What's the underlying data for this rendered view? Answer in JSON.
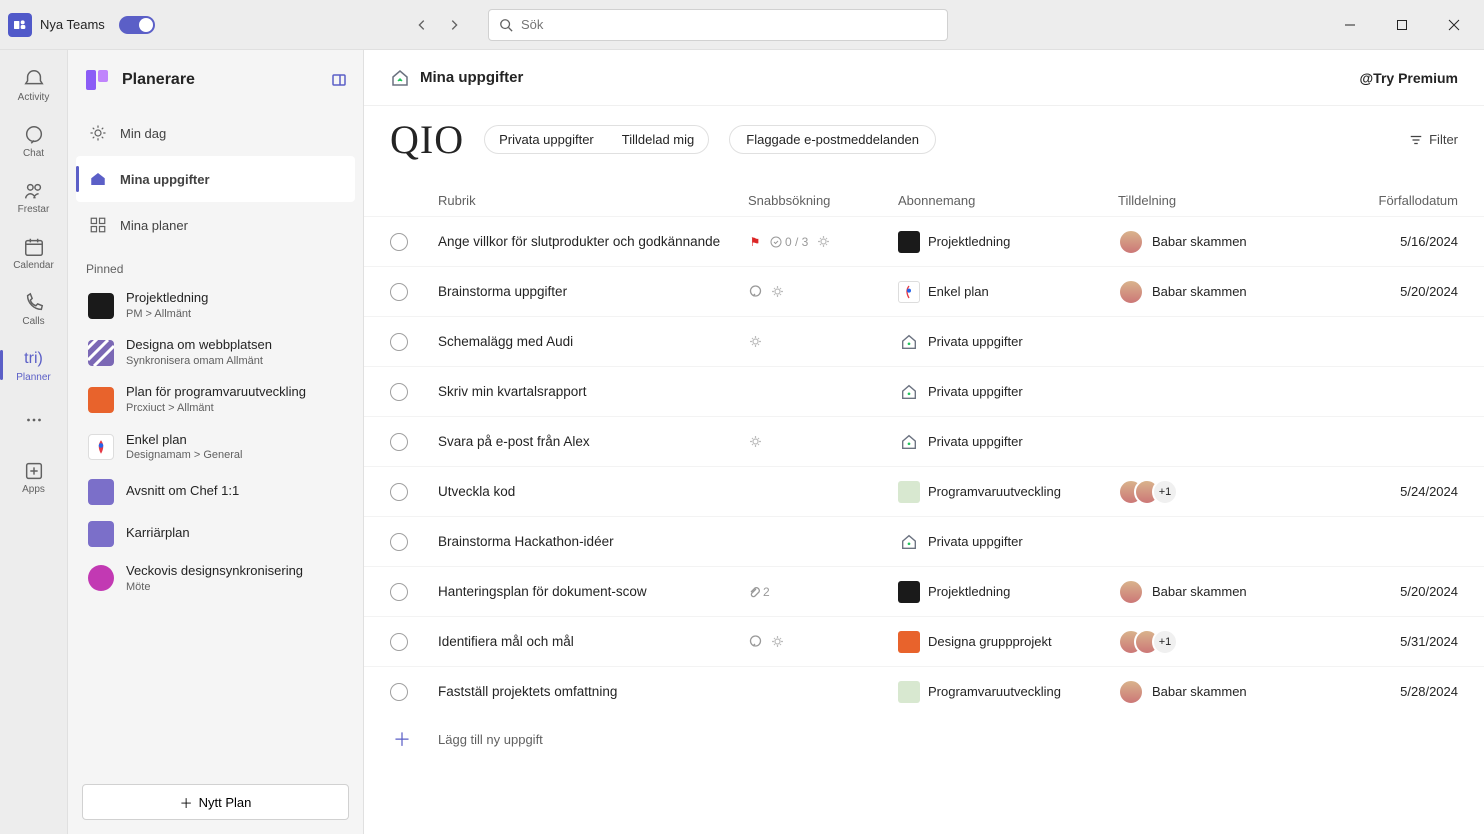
{
  "titlebar": {
    "appName": "Nya Teams",
    "searchPlaceholder": "Sök"
  },
  "rail": [
    {
      "id": "activity",
      "label": "Activity"
    },
    {
      "id": "chat",
      "label": "Chat"
    },
    {
      "id": "frestar",
      "label": "Frestar"
    },
    {
      "id": "calendar",
      "label": "Calendar"
    },
    {
      "id": "calls",
      "label": "Calls"
    },
    {
      "id": "planner",
      "label": "Planner",
      "active": true,
      "text": "tri)"
    },
    {
      "id": "more",
      "label": ""
    },
    {
      "id": "apps",
      "label": "Apps"
    }
  ],
  "sidebar": {
    "title": "Planerare",
    "nav": [
      {
        "id": "myday",
        "label": "Min dag"
      },
      {
        "id": "mytasks",
        "label": "Mina uppgifter",
        "active": true
      },
      {
        "id": "myplans",
        "label": "Mina planer"
      }
    ],
    "pinnedLabel": "Pinned",
    "pinned": [
      {
        "title": "Projektledning",
        "sub": "PM &gt; Allmänt",
        "color": "#1a1a1a"
      },
      {
        "title": "Designa om webbplatsen",
        "sub": "Synkronisera omam Allmänt",
        "color": "#7b68b5",
        "striped": true
      },
      {
        "title": "Plan för programvaruutveckling",
        "sub": "Prcxiuct &gt; Allmänt",
        "color": "#e8632c"
      },
      {
        "title": "Enkel plan",
        "sub": "Designamam &gt; General",
        "color": "#fff",
        "outlined": true
      },
      {
        "title": "Avsnitt om Chef 1:1",
        "sub": "",
        "color": "#7b6fc9"
      },
      {
        "title": "Karriärplan",
        "sub": "",
        "color": "#7b6fc9"
      },
      {
        "title": "Veckovis designsynkronisering",
        "sub": "Möte",
        "color": "#c239b3",
        "circle": true
      }
    ],
    "newPlanLabel": "Nytt  Plan"
  },
  "main": {
    "headerTitle": "Mina uppgifter",
    "premium": "@Try Premium",
    "qio": "QIO",
    "tabs": {
      "privata": "Privata uppgifter",
      "tilldelad": "Tilldelad mig",
      "flaggade": "Flaggade e-postmeddelanden"
    },
    "filterLabel": "Filter",
    "columns": {
      "title": "Rubrik",
      "quick": "Snabbsökning",
      "sub": "Abonnemang",
      "assign": "Tilldelning",
      "due": "Förfallodatum"
    },
    "addTaskLabel": "Lägg till ny uppgift",
    "tasks": [
      {
        "title": "Ange villkor för slutprodukter och godkännande",
        "quick": {
          "flag": true,
          "check": "0 / 3",
          "sun": true
        },
        "sub": {
          "name": "Projektledning",
          "color": "#1a1a1a"
        },
        "assign": {
          "avatars": 1,
          "name": "Babar skammen"
        },
        "due": "5/16/2024"
      },
      {
        "title": "Brainstorma uppgifter",
        "quick": {
          "note": true,
          "sun": true
        },
        "sub": {
          "name": "Enkel plan",
          "color": "#fff",
          "outlined": true,
          "swirl": true
        },
        "assign": {
          "avatars": 1,
          "name": "Babar skammen"
        },
        "due": "5/20/2024"
      },
      {
        "title": "Schemalägg med Audi",
        "quick": {
          "sun": true
        },
        "sub": {
          "name": "Privata uppgifter",
          "house": true
        },
        "assign": null,
        "due": ""
      },
      {
        "title": "Skriv min kvartalsrapport",
        "quick": {},
        "sub": {
          "name": "Privata uppgifter",
          "house": true
        },
        "assign": null,
        "due": ""
      },
      {
        "title": "Svara på e-post från Alex",
        "quick": {
          "sun": true
        },
        "sub": {
          "name": "Privata uppgifter",
          "house": true
        },
        "assign": null,
        "due": ""
      },
      {
        "title": "Utveckla kod",
        "quick": {},
        "sub": {
          "name": "Programvaruutveckling",
          "color": "#d8e8d0",
          "text": "#333"
        },
        "assign": {
          "avatars": 2,
          "more": "+1"
        },
        "due": "5/24/2024"
      },
      {
        "title": "Brainstorma Hackathon-idéer",
        "quick": {},
        "sub": {
          "name": "Privata uppgifter",
          "house": true
        },
        "assign": null,
        "due": ""
      },
      {
        "title": "Hanteringsplan för dokument-scow",
        "quick": {
          "attach": "2"
        },
        "sub": {
          "name": "Projektledning",
          "color": "#1a1a1a"
        },
        "assign": {
          "avatars": 1,
          "name": "Babar skammen"
        },
        "due": "5/20/2024"
      },
      {
        "title": "Identifiera mål och mål",
        "quick": {
          "note": true,
          "sun": true
        },
        "sub": {
          "name": "Designa gruppprojekt",
          "color": "#e8632c"
        },
        "assign": {
          "avatars": 2,
          "more": "+1"
        },
        "due": "5/31/2024"
      },
      {
        "title": "Fastställ projektets omfattning",
        "quick": {},
        "sub": {
          "name": "Programvaruutveckling",
          "color": "#d8e8d0",
          "text": "#333"
        },
        "assign": {
          "avatars": 1,
          "name": "Babar skammen"
        },
        "due": "5/28/2024"
      }
    ]
  }
}
